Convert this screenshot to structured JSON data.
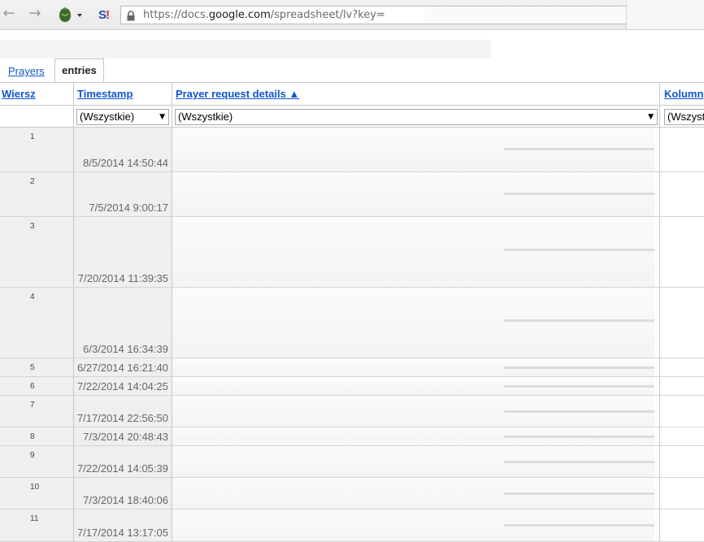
{
  "browser": {
    "url_prefix": "https://docs.",
    "url_domain": "google.com",
    "url_suffix": "/spreadsheet/lv?key="
  },
  "tabs": [
    {
      "label": "Prayers",
      "active": false
    },
    {
      "label": "entries",
      "active": true
    }
  ],
  "columns": {
    "row": "Wiersz",
    "timestamp": "Timestamp",
    "details": "Prayer request details ▲",
    "next": "Kolumn"
  },
  "filters": {
    "timestamp": "(Wszystkie)",
    "details": "(Wszystkie)",
    "next": "(Wszysti"
  },
  "rows": [
    {
      "num": "1",
      "timestamp": "8/5/2014 14:50:44"
    },
    {
      "num": "2",
      "timestamp": "7/5/2014 9:00:17"
    },
    {
      "num": "3",
      "timestamp": "7/20/2014 11:39:35"
    },
    {
      "num": "4",
      "timestamp": "6/3/2014 16:34:39"
    },
    {
      "num": "5",
      "timestamp": "6/27/2014 16:21:40"
    },
    {
      "num": "6",
      "timestamp": "7/22/2014 14:04:25"
    },
    {
      "num": "7",
      "timestamp": "7/17/2014 22:56:50"
    },
    {
      "num": "8",
      "timestamp": "7/3/2014 20:48:43"
    },
    {
      "num": "9",
      "timestamp": "7/22/2014 14:05:39"
    },
    {
      "num": "10",
      "timestamp": "7/3/2014 18:40:06"
    },
    {
      "num": "11",
      "timestamp": "7/17/2014 13:17:05"
    }
  ],
  "colors": {
    "link": "#1155cc",
    "header_cell_bg": "#efefef",
    "grid_line": "#c8c8c8"
  }
}
